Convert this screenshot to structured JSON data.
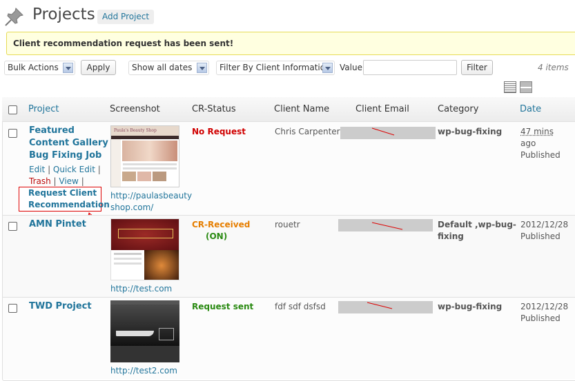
{
  "header": {
    "title": "Projects",
    "add_button": "Add Project"
  },
  "notice": {
    "message": "Client recommendation request has been sent!"
  },
  "filters": {
    "bulk_actions": "Bulk Actions",
    "apply": "Apply",
    "dates": "Show all dates",
    "client_filter": "Filter By Client Information",
    "value_label": "Value:",
    "value_input": "",
    "filter_button": "Filter",
    "items_count": "4 items"
  },
  "columns": {
    "project": "Project",
    "screenshot": "Screenshot",
    "cr_status": "CR-Status",
    "client_name": "Client Name",
    "client_email": "Client Email",
    "category": "Category",
    "date": "Date"
  },
  "rows": [
    {
      "title_line1": "Featured",
      "title_line2": "Content Gallery",
      "title_line3": "Bug Fixing Job",
      "edit": "Edit",
      "quick_edit": "Quick Edit",
      "trash": "Trash",
      "view": "View",
      "request_line1": "Request Client",
      "request_line2": "Recommendation",
      "url_line1": "http://paulasbeauty",
      "url_line2": "shop.com/",
      "thumb_caption": "Paula's Beauty Shop",
      "status": "No Request",
      "status_color": "#d00000",
      "client_name": "Chris Carpenter",
      "category": "wp-bug-fixing",
      "date_line1": "47 mins",
      "date_line2": "ago",
      "date_status": "Published"
    },
    {
      "title_line1": "AMN Pintet",
      "url_line1": "http://test.com",
      "status": "CR-Received",
      "status_sub": "(ON)",
      "status_color": "#e67e00",
      "status_sub_color": "#2a8a12",
      "client_name": "rouetr",
      "category_line1": "Default ,wp-bug-",
      "category_line2": "fixing",
      "date_line1": "2012/12/28",
      "date_status": "Published"
    },
    {
      "title_line1": "TWD Project",
      "url_line1": "http://test2.com",
      "status": "Request sent",
      "status_color": "#2a8a12",
      "client_name": "fdf sdf dsfsd",
      "category": "wp-bug-fixing",
      "date_line1": "2012/12/28",
      "date_status": "Published"
    }
  ]
}
